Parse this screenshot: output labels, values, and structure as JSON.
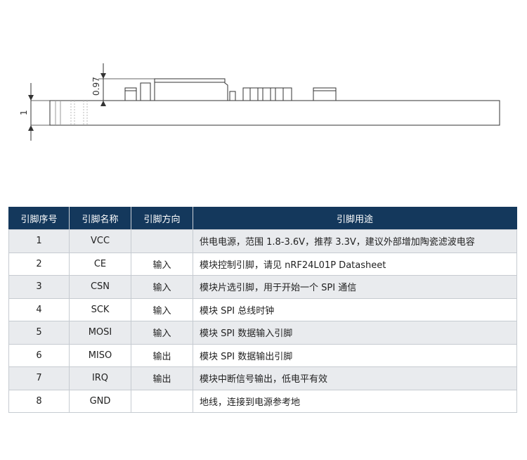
{
  "drawing": {
    "dimension_top": "0.97",
    "dimension_side": "1"
  },
  "table": {
    "headers": [
      "引脚序号",
      "引脚名称",
      "引脚方向",
      "引脚用途"
    ],
    "rows": [
      {
        "num": "1",
        "name": "VCC",
        "dir": "",
        "use": "供电电源，范围 1.8-3.6V，推荐 3.3V，建议外部增加陶瓷滤波电容"
      },
      {
        "num": "2",
        "name": "CE",
        "dir": "输入",
        "use": "模块控制引脚，请见 nRF24L01P Datasheet"
      },
      {
        "num": "3",
        "name": "CSN",
        "dir": "输入",
        "use": "模块片选引脚，用于开始一个 SPI 通信"
      },
      {
        "num": "4",
        "name": "SCK",
        "dir": "输入",
        "use": "模块 SPI 总线时钟"
      },
      {
        "num": "5",
        "name": "MOSI",
        "dir": "输入",
        "use": "模块 SPI 数据输入引脚"
      },
      {
        "num": "6",
        "name": "MISO",
        "dir": "输出",
        "use": "模块 SPI 数据输出引脚"
      },
      {
        "num": "7",
        "name": "IRQ",
        "dir": "输出",
        "use": "模块中断信号输出，低电平有效"
      },
      {
        "num": "8",
        "name": "GND",
        "dir": "",
        "use": "地线，连接到电源参考地"
      }
    ]
  }
}
